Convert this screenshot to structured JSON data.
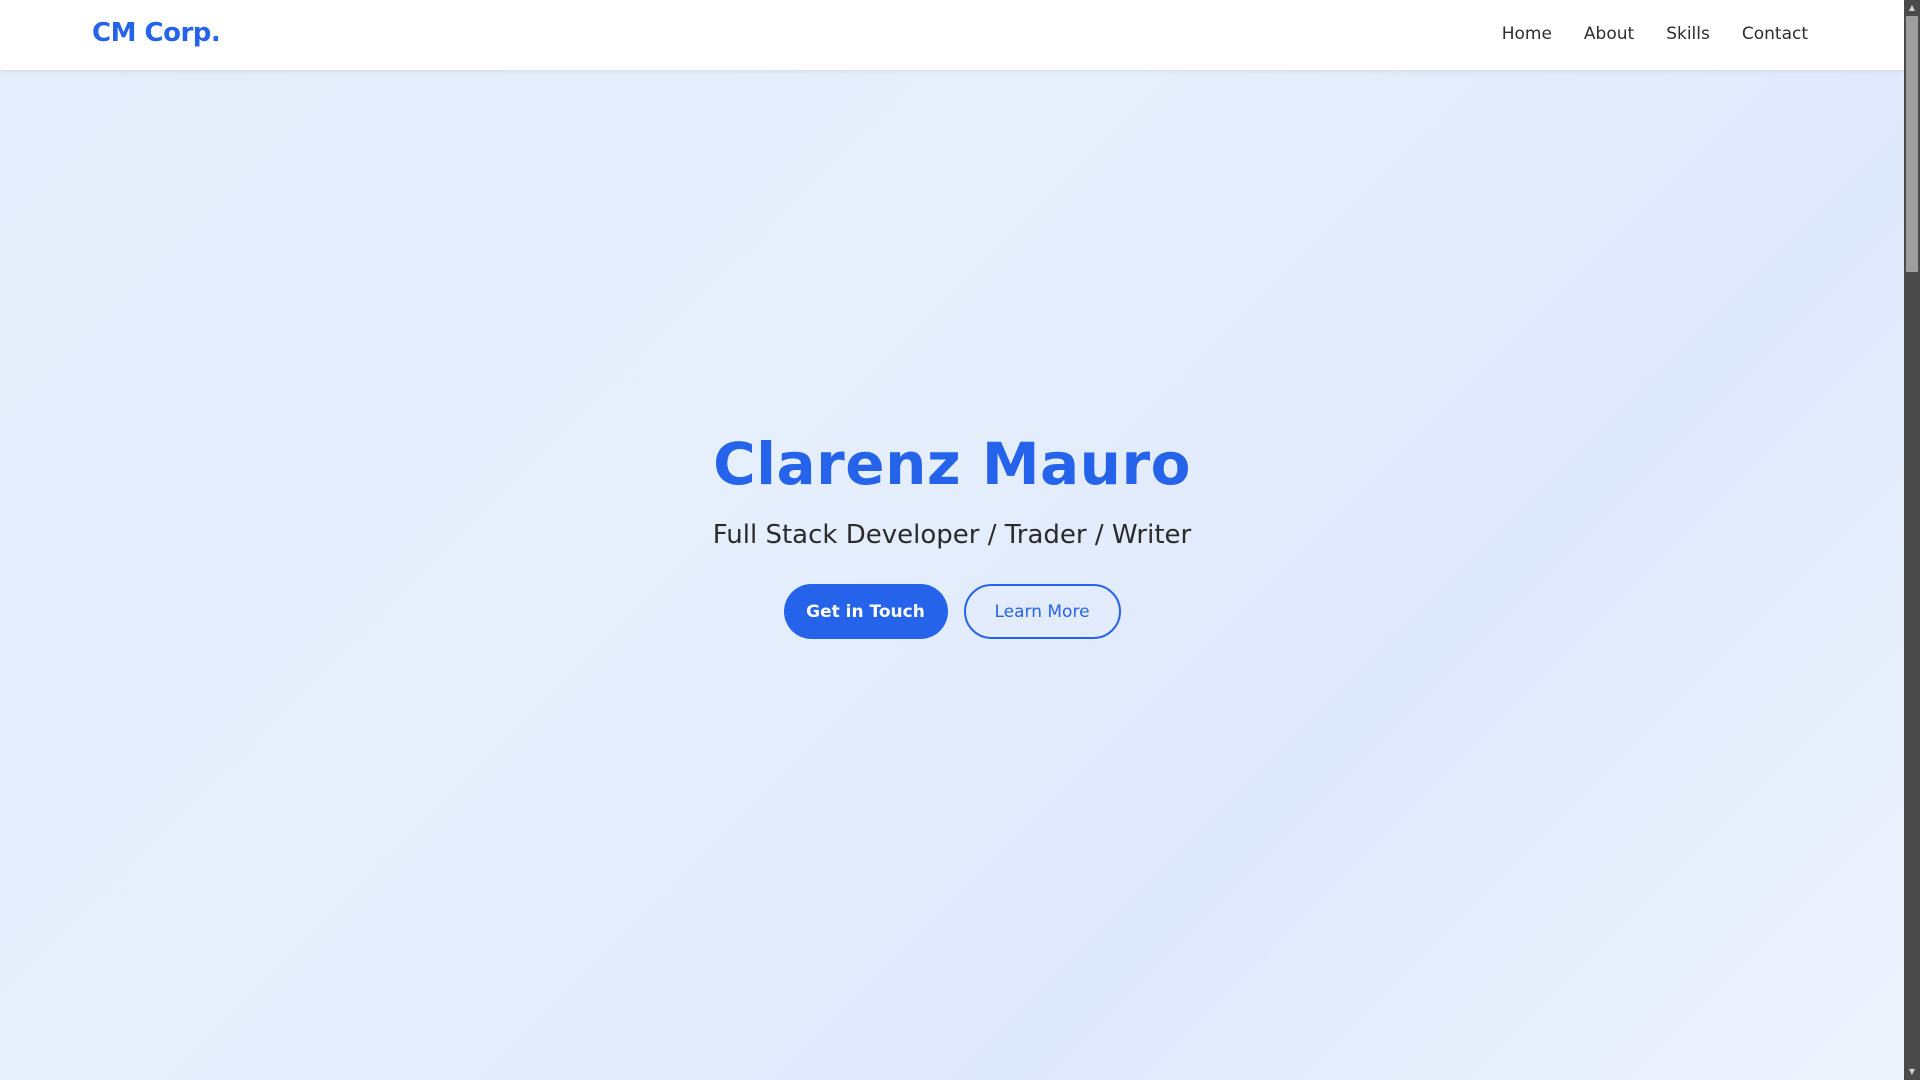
{
  "navbar": {
    "brand": "CM Corp.",
    "links": [
      "Home",
      "About",
      "Skills",
      "Contact"
    ]
  },
  "hero": {
    "title": "Clarenz Mauro",
    "subtitle": "Full Stack Developer / Trader / Writer",
    "primary_button": "Get in Touch",
    "secondary_button": "Learn More"
  },
  "colors": {
    "accent": "#2563eb",
    "navbar_bg": "#ffffff",
    "hero_bg": "#e3edfb",
    "text": "#2b2b2b"
  },
  "icons": {
    "scroll_up": "scroll-up-arrow-icon",
    "scroll_down": "scroll-down-arrow-icon"
  }
}
